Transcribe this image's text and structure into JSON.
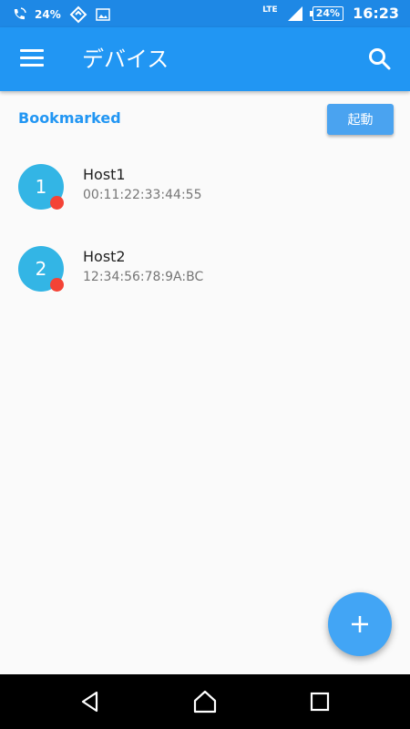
{
  "status_bar": {
    "left_percent": "24%",
    "network": "LTE",
    "battery": "24%",
    "time": "16:23",
    "icons": [
      "wifi-call-icon",
      "sync-icon",
      "image-icon",
      "signal-icon",
      "battery-icon"
    ]
  },
  "app_bar": {
    "title": "デバイス",
    "icons": [
      "menu-icon",
      "search-icon"
    ]
  },
  "section": {
    "label": "Bookmarked",
    "start_button": "起動"
  },
  "devices": [
    {
      "number": "1",
      "name": "Host1",
      "mac": "00:11:22:33:44:55"
    },
    {
      "number": "2",
      "name": "Host2",
      "mac": "12:34:56:78:9A:BC"
    }
  ],
  "fab": {
    "icon": "plus-icon"
  },
  "nav_bar": {
    "icons": [
      "back-icon",
      "home-icon",
      "recents-icon"
    ]
  },
  "colors": {
    "status_bar": "#1e88e5",
    "app_bar": "#2196f3",
    "accent": "#2196f3",
    "avatar": "#33b5e5",
    "status_dot": "#f44336",
    "fab": "#42a5f5"
  }
}
